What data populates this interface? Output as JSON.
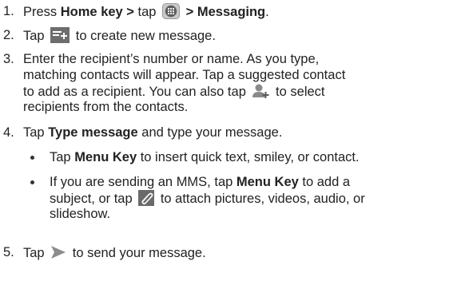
{
  "steps": [
    {
      "num": "1.",
      "t1": "Press ",
      "b1": "Home key >",
      "t2": " tap ",
      "icon": "apps-icon",
      "b2": " > Messaging",
      "t3": "."
    },
    {
      "num": "2.",
      "t1": "Tap ",
      "icon": "new-message-icon",
      "t2": " to create new message."
    },
    {
      "num": "3.",
      "line1": "Enter the recipient’s number or name. As you type,",
      "line2": "matching contacts will appear. Tap a suggested contact",
      "line3a": "to add as a recipient. You can also tap ",
      "icon": "add-contact-icon",
      "line3b": " to select",
      "line4": "recipients from the contacts."
    },
    {
      "num": "4.",
      "t1": "Tap ",
      "b1": "Type message",
      "t2": " and type your message.",
      "bullets": [
        {
          "t1": "Tap ",
          "b1": "Menu Key",
          "t2": " to insert quick text, smiley, or contact."
        },
        {
          "t1": "If you are sending an MMS, tap ",
          "b1": "Menu Key",
          "t2": " to add a",
          "line2a": "subject, or tap ",
          "icon": "attach-icon",
          "line2b": " to attach pictures, videos, audio, or",
          "line3": "slideshow."
        }
      ]
    },
    {
      "num": "5.",
      "t1": "Tap ",
      "icon": "send-icon",
      "t2": " to send your message."
    }
  ]
}
